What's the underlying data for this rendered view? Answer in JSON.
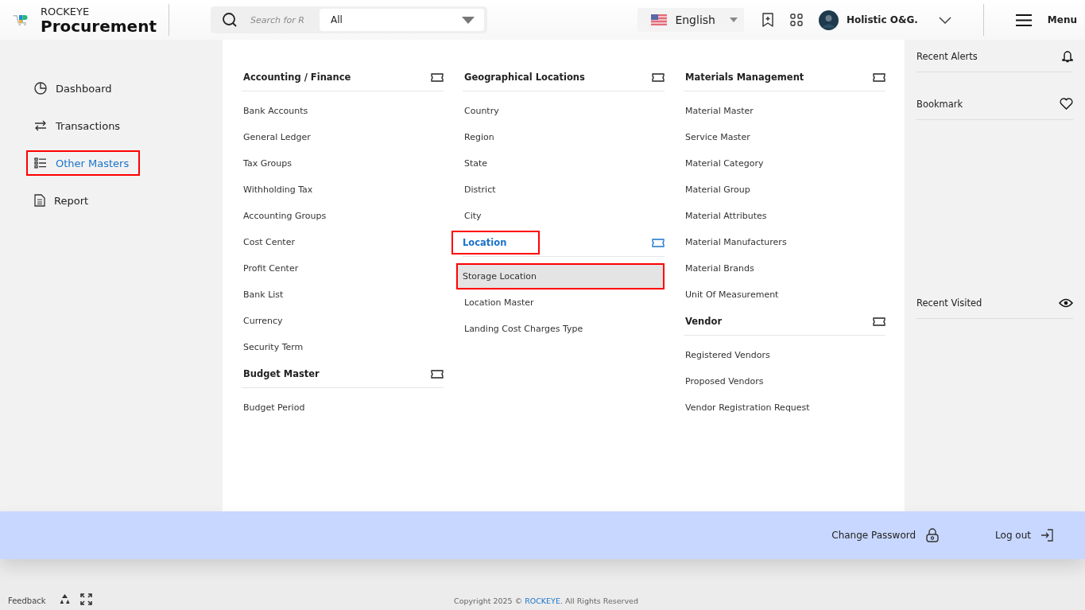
{
  "brand": {
    "top": "ROCKEYE",
    "name": "Procurement"
  },
  "search": {
    "placeholder": "Search for R",
    "scope": "All"
  },
  "language": {
    "label": "English"
  },
  "user": {
    "name": "Holistic O&G."
  },
  "menu_button": {
    "label": "Menu"
  },
  "sidebar": {
    "items": [
      {
        "label": "Dashboard",
        "kind": "dashboard",
        "selected": false,
        "highlighted": false
      },
      {
        "label": "Transactions",
        "kind": "transactions",
        "selected": false,
        "highlighted": false
      },
      {
        "label": "Other Masters",
        "kind": "masters",
        "selected": true,
        "highlighted": true
      },
      {
        "label": "Report",
        "kind": "report",
        "selected": false,
        "highlighted": false
      }
    ]
  },
  "mega_menu": {
    "columns": [
      {
        "groups": [
          {
            "title": "Accounting / Finance",
            "selected": false,
            "highlighted": false,
            "items": [
              {
                "label": "Bank Accounts",
                "selected": false,
                "highlighted": false
              },
              {
                "label": "General Ledger",
                "selected": false,
                "highlighted": false
              },
              {
                "label": "Tax Groups",
                "selected": false,
                "highlighted": false
              },
              {
                "label": "Withholding Tax",
                "selected": false,
                "highlighted": false
              },
              {
                "label": "Accounting Groups",
                "selected": false,
                "highlighted": false
              },
              {
                "label": "Cost Center",
                "selected": false,
                "highlighted": false
              },
              {
                "label": "Profit Center",
                "selected": false,
                "highlighted": false
              },
              {
                "label": "Bank List",
                "selected": false,
                "highlighted": false
              },
              {
                "label": "Currency",
                "selected": false,
                "highlighted": false
              },
              {
                "label": "Security Term",
                "selected": false,
                "highlighted": false
              }
            ]
          },
          {
            "title": "Budget Master",
            "selected": false,
            "highlighted": false,
            "items": [
              {
                "label": "Budget Period",
                "selected": false,
                "highlighted": false
              }
            ]
          }
        ]
      },
      {
        "groups": [
          {
            "title": "Geographical Locations",
            "selected": false,
            "highlighted": false,
            "items": [
              {
                "label": "Country",
                "selected": false,
                "highlighted": false
              },
              {
                "label": "Region",
                "selected": false,
                "highlighted": false
              },
              {
                "label": "State",
                "selected": false,
                "highlighted": false
              },
              {
                "label": "District",
                "selected": false,
                "highlighted": false
              },
              {
                "label": "City",
                "selected": false,
                "highlighted": false
              }
            ]
          },
          {
            "title": "Location",
            "selected": true,
            "highlighted": true,
            "items": [
              {
                "label": "Storage Location",
                "selected": true,
                "highlighted": true
              },
              {
                "label": "Location Master",
                "selected": false,
                "highlighted": false
              },
              {
                "label": "Landing Cost Charges Type",
                "selected": false,
                "highlighted": false
              }
            ]
          }
        ]
      },
      {
        "groups": [
          {
            "title": "Materials Management",
            "selected": false,
            "highlighted": false,
            "items": [
              {
                "label": "Material Master",
                "selected": false,
                "highlighted": false
              },
              {
                "label": "Service Master",
                "selected": false,
                "highlighted": false
              },
              {
                "label": "Material Category",
                "selected": false,
                "highlighted": false
              },
              {
                "label": "Material Group",
                "selected": false,
                "highlighted": false
              },
              {
                "label": "Material Attributes",
                "selected": false,
                "highlighted": false
              },
              {
                "label": "Material Manufacturers",
                "selected": false,
                "highlighted": false
              },
              {
                "label": "Material Brands",
                "selected": false,
                "highlighted": false
              },
              {
                "label": "Unit Of Measurement",
                "selected": false,
                "highlighted": false
              }
            ]
          },
          {
            "title": "Vendor",
            "selected": false,
            "highlighted": false,
            "items": [
              {
                "label": "Registered Vendors",
                "selected": false,
                "highlighted": false
              },
              {
                "label": "Proposed Vendors",
                "selected": false,
                "highlighted": false
              },
              {
                "label": "Vendor Registration Request",
                "selected": false,
                "highlighted": false
              }
            ]
          }
        ]
      }
    ]
  },
  "right_panel": {
    "sections": [
      {
        "title": "Recent Alerts",
        "kind": "alerts"
      },
      {
        "title": "Bookmark",
        "kind": "bookmark"
      },
      {
        "title": "Recent Visited",
        "kind": "visited"
      }
    ]
  },
  "account_bar": {
    "change_password": "Change Password",
    "logout": "Log out"
  },
  "footer": {
    "feedback": "Feedback",
    "copyright_prefix": "Copyright 2025 ©",
    "copyright_link": "ROCKEYE.",
    "copyright_suffix": "All Rights Reserved"
  }
}
